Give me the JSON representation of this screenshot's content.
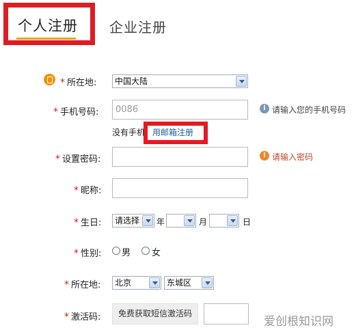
{
  "tabs": {
    "personal": "个人注册",
    "company": "企业注册"
  },
  "form": {
    "required_mark": "*",
    "location_label": "所在地:",
    "region_select": "中国大陆",
    "phone_label": "手机号码:",
    "phone_value": "0086",
    "phone_hint": "请输入您的手机号码",
    "no_phone_text": "没有手机？",
    "email_register_link": "用邮箱注册",
    "password_label": "设置密码:",
    "password_hint": "请输入密码",
    "nickname_label": "昵称:",
    "birthday_label": "生日:",
    "birthday_year_select": "请选择",
    "year_unit": "年",
    "month_unit": "月",
    "day_unit": "日",
    "gender_label": "性别:",
    "gender_male": "男",
    "gender_female": "女",
    "city_label": "所在地:",
    "province_select": "北京",
    "district_select": "东城区",
    "activation_label": "激活码:",
    "sms_button": "免费获取短信激活码"
  },
  "watermark": "爱创根知识网",
  "colors": {
    "highlight_red": "#e11b22",
    "accent_orange": "#f29100",
    "link_blue": "#1d5fa8",
    "required_red": "#d0201b"
  }
}
